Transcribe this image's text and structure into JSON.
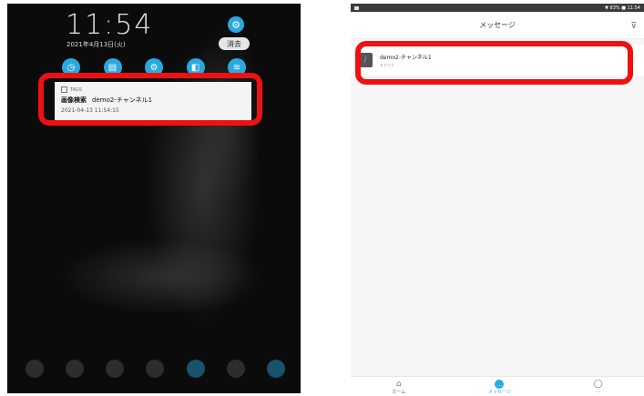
{
  "left_screen": {
    "clock": "11:54",
    "date": "2021年4月13日(火)",
    "clear_label": "消去",
    "quick_settings": [
      {
        "icon": "speedometer-icon",
        "glyph": "◷"
      },
      {
        "icon": "memo-icon",
        "glyph": "▤"
      },
      {
        "icon": "settings-icon",
        "glyph": "⚙"
      },
      {
        "icon": "flashlight-icon",
        "glyph": "◧"
      },
      {
        "icon": "wifi-icon",
        "glyph": "≋"
      }
    ],
    "notification": {
      "app_name": "TAGS",
      "sender": "画像検索",
      "message": "demo2-チャンネル1",
      "time": "2021-04-13 11:54:15"
    }
  },
  "right_screen": {
    "status_right": "▼ 83% ■ 11:54",
    "header_title": "メッセージ",
    "message": {
      "name": "demo2-チャンネル1",
      "preview": "テナント"
    },
    "nav": [
      {
        "label": "ホーム",
        "glyph": "⌂",
        "icon": "home-icon",
        "active": false
      },
      {
        "label": "メッセージ",
        "glyph": "…",
        "icon": "message-icon",
        "active": true
      },
      {
        "label": "…",
        "glyph": "◯",
        "icon": "profile-icon",
        "active": false
      }
    ]
  },
  "colors": {
    "accent": "#29a9e0",
    "highlight": "#ee1111"
  }
}
